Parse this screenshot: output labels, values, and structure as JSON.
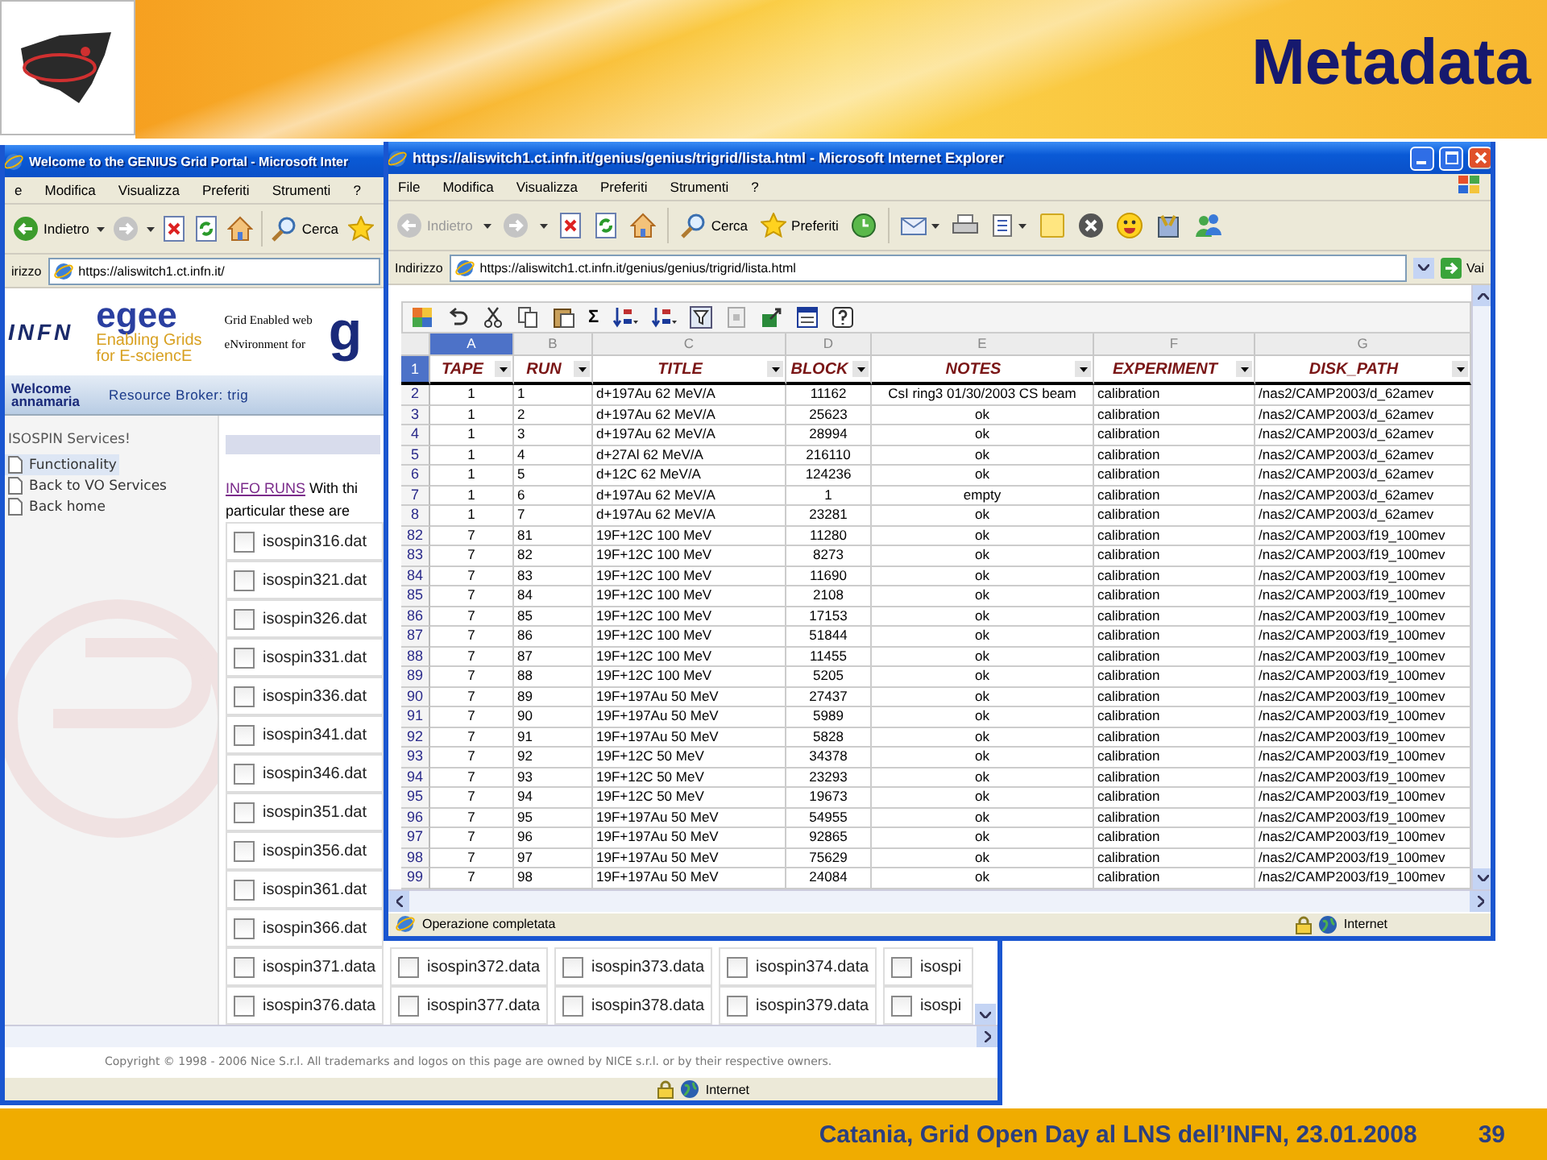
{
  "slide": {
    "title": "Metadata",
    "footer": "Catania, Grid Open Day al LNS dell’INFN, 23.01.2008",
    "page": "39"
  },
  "back_window": {
    "title": "Welcome to the GENIUS Grid Portal - Microsoft Inter",
    "menu": [
      "e",
      "Modifica",
      "Visualizza",
      "Preferiti",
      "Strumenti",
      "?"
    ],
    "back_button": {
      "label": "Indietro",
      "disabled": false
    },
    "search_button": "Cerca",
    "address_label": "irizzo",
    "url": "https://aliswitch1.ct.infn.it/",
    "logos": {
      "infn": "INFN",
      "egee": "egee",
      "egee_tagline": [
        "Enabling Grids",
        "for E-sciencE"
      ],
      "genius_tagline": [
        "Grid Enabled web",
        "eNvironment for"
      ],
      "genius": "g"
    },
    "welcome": [
      "Welcome",
      "annamaria"
    ],
    "broker": "Resource Broker: trig",
    "services_title": "ISOSPIN Services!",
    "nav": [
      {
        "label": "Functionality",
        "selected": true
      },
      {
        "label": "Back to VO Services",
        "selected": false
      },
      {
        "label": "Back home",
        "selected": false
      }
    ],
    "info_link": "INFO RUNS",
    "info_text": [
      "With thi",
      "particular these are"
    ],
    "files": [
      [
        {
          "name": "isospin316.dat",
          "checked": false
        }
      ],
      [
        {
          "name": "isospin321.dat",
          "checked": false
        }
      ],
      [
        {
          "name": "isospin326.dat",
          "checked": false
        }
      ],
      [
        {
          "name": "isospin331.dat",
          "checked": false
        }
      ],
      [
        {
          "name": "isospin336.dat",
          "checked": false
        }
      ],
      [
        {
          "name": "isospin341.dat",
          "checked": false
        }
      ],
      [
        {
          "name": "isospin346.dat",
          "checked": false
        }
      ],
      [
        {
          "name": "isospin351.dat",
          "checked": false
        }
      ],
      [
        {
          "name": "isospin356.dat",
          "checked": false
        }
      ],
      [
        {
          "name": "isospin361.dat",
          "checked": false
        }
      ],
      [
        {
          "name": "isospin366.dat",
          "checked": false
        }
      ],
      [
        {
          "name": "isospin371.data",
          "checked": false
        },
        {
          "name": "isospin372.data",
          "checked": false
        },
        {
          "name": "isospin373.data",
          "checked": false
        },
        {
          "name": "isospin374.data",
          "checked": false
        },
        {
          "name": "isospi",
          "checked": false
        }
      ],
      [
        {
          "name": "isospin376.data",
          "checked": false
        },
        {
          "name": "isospin377.data",
          "checked": false
        },
        {
          "name": "isospin378.data",
          "checked": false
        },
        {
          "name": "isospin379.data",
          "checked": false
        },
        {
          "name": "isospi",
          "checked": false
        }
      ]
    ],
    "copyright": "Copyright © 1998 - 2006 Nice S.r.l. All trademarks and logos on this page are owned by NICE s.r.l. or by their respective owners.",
    "status_zone": "Internet"
  },
  "front_window": {
    "title": "https://aliswitch1.ct.infn.it/genius/genius/trigrid/lista.html - Microsoft Internet Explorer",
    "menu": [
      "File",
      "Modifica",
      "Visualizza",
      "Preferiti",
      "Strumenti",
      "?"
    ],
    "back_button": {
      "label": "Indietro",
      "disabled": true
    },
    "search_button": "Cerca",
    "favorites_button": "Preferiti",
    "address_label": "Indirizzo",
    "url": "https://aliswitch1.ct.infn.it/genius/genius/trigrid/lista.html",
    "go_button": "Vai",
    "sheet_toolbar": [
      {
        "kind": "office"
      },
      {
        "kind": "undo"
      },
      {
        "kind": "cut"
      },
      {
        "kind": "copy"
      },
      {
        "kind": "paste"
      },
      {
        "kind": "sum",
        "glyph": "Σ"
      },
      {
        "kind": "sort"
      },
      {
        "kind": "sort"
      },
      {
        "kind": "filter"
      },
      {
        "kind": "refresh"
      },
      {
        "kind": "export"
      },
      {
        "kind": "form"
      },
      {
        "kind": "help"
      }
    ],
    "columns": [
      {
        "letter": "A",
        "selected": true
      },
      {
        "letter": "B",
        "selected": false
      },
      {
        "letter": "C",
        "selected": false
      },
      {
        "letter": "D",
        "selected": false
      },
      {
        "letter": "E",
        "selected": false
      },
      {
        "letter": "F",
        "selected": false
      },
      {
        "letter": "G",
        "selected": false
      }
    ],
    "header_row": {
      "n": "1",
      "selected": true,
      "fields": [
        "TAPE",
        "RUN",
        "TITLE",
        "BLOCK",
        "NOTES",
        "EXPERIMENT",
        "DISK_PATH"
      ]
    },
    "rows": [
      {
        "n": "2",
        "cells": [
          "1",
          "1",
          "d+197Au 62 MeV/A",
          "11162",
          "CsI ring3 01/30/2003 CS beam",
          "calibration",
          "/nas2/CAMP2003/d_62amev"
        ]
      },
      {
        "n": "3",
        "cells": [
          "1",
          "2",
          "d+197Au 62 MeV/A",
          "25623",
          "ok",
          "calibration",
          "/nas2/CAMP2003/d_62amev"
        ]
      },
      {
        "n": "4",
        "cells": [
          "1",
          "3",
          "d+197Au 62 MeV/A",
          "28994",
          "ok",
          "calibration",
          "/nas2/CAMP2003/d_62amev"
        ]
      },
      {
        "n": "5",
        "cells": [
          "1",
          "4",
          "d+27Al 62 MeV/A",
          "216110",
          "ok",
          "calibration",
          "/nas2/CAMP2003/d_62amev"
        ]
      },
      {
        "n": "6",
        "cells": [
          "1",
          "5",
          "d+12C 62 MeV/A",
          "124236",
          "ok",
          "calibration",
          "/nas2/CAMP2003/d_62amev"
        ]
      },
      {
        "n": "7",
        "cells": [
          "1",
          "6",
          "d+197Au 62 MeV/A",
          "1",
          "empty",
          "calibration",
          "/nas2/CAMP2003/d_62amev"
        ]
      },
      {
        "n": "8",
        "cells": [
          "1",
          "7",
          "d+197Au 62 MeV/A",
          "23281",
          "ok",
          "calibration",
          "/nas2/CAMP2003/d_62amev"
        ]
      },
      {
        "n": "82",
        "cells": [
          "7",
          "81",
          "19F+12C 100 MeV",
          "11280",
          "ok",
          "calibration",
          "/nas2/CAMP2003/f19_100mev"
        ]
      },
      {
        "n": "83",
        "cells": [
          "7",
          "82",
          "19F+12C 100 MeV",
          "8273",
          "ok",
          "calibration",
          "/nas2/CAMP2003/f19_100mev"
        ]
      },
      {
        "n": "84",
        "cells": [
          "7",
          "83",
          "19F+12C 100 MeV",
          "11690",
          "ok",
          "calibration",
          "/nas2/CAMP2003/f19_100mev"
        ]
      },
      {
        "n": "85",
        "cells": [
          "7",
          "84",
          "19F+12C 100 MeV",
          "2108",
          "ok",
          "calibration",
          "/nas2/CAMP2003/f19_100mev"
        ]
      },
      {
        "n": "86",
        "cells": [
          "7",
          "85",
          "19F+12C 100 MeV",
          "17153",
          "ok",
          "calibration",
          "/nas2/CAMP2003/f19_100mev"
        ]
      },
      {
        "n": "87",
        "cells": [
          "7",
          "86",
          "19F+12C 100 MeV",
          "51844",
          "ok",
          "calibration",
          "/nas2/CAMP2003/f19_100mev"
        ]
      },
      {
        "n": "88",
        "cells": [
          "7",
          "87",
          "19F+12C 100 MeV",
          "11455",
          "ok",
          "calibration",
          "/nas2/CAMP2003/f19_100mev"
        ]
      },
      {
        "n": "89",
        "cells": [
          "7",
          "88",
          "19F+12C 100 MeV",
          "5205",
          "ok",
          "calibration",
          "/nas2/CAMP2003/f19_100mev"
        ]
      },
      {
        "n": "90",
        "cells": [
          "7",
          "89",
          "19F+197Au 50 MeV",
          "27437",
          "ok",
          "calibration",
          "/nas2/CAMP2003/f19_100mev"
        ]
      },
      {
        "n": "91",
        "cells": [
          "7",
          "90",
          "19F+197Au 50 MeV",
          "5989",
          "ok",
          "calibration",
          "/nas2/CAMP2003/f19_100mev"
        ]
      },
      {
        "n": "92",
        "cells": [
          "7",
          "91",
          "19F+197Au 50 MeV",
          "5828",
          "ok",
          "calibration",
          "/nas2/CAMP2003/f19_100mev"
        ]
      },
      {
        "n": "93",
        "cells": [
          "7",
          "92",
          "19F+12C 50 MeV",
          "34378",
          "ok",
          "calibration",
          "/nas2/CAMP2003/f19_100mev"
        ]
      },
      {
        "n": "94",
        "cells": [
          "7",
          "93",
          "19F+12C 50 MeV",
          "23293",
          "ok",
          "calibration",
          "/nas2/CAMP2003/f19_100mev"
        ]
      },
      {
        "n": "95",
        "cells": [
          "7",
          "94",
          "19F+12C 50 MeV",
          "19673",
          "ok",
          "calibration",
          "/nas2/CAMP2003/f19_100mev"
        ]
      },
      {
        "n": "96",
        "cells": [
          "7",
          "95",
          "19F+197Au 50 MeV",
          "54955",
          "ok",
          "calibration",
          "/nas2/CAMP2003/f19_100mev"
        ]
      },
      {
        "n": "97",
        "cells": [
          "7",
          "96",
          "19F+197Au 50 MeV",
          "92865",
          "ok",
          "calibration",
          "/nas2/CAMP2003/f19_100mev"
        ]
      },
      {
        "n": "98",
        "cells": [
          "7",
          "97",
          "19F+197Au 50 MeV",
          "75629",
          "ok",
          "calibration",
          "/nas2/CAMP2003/f19_100mev"
        ]
      },
      {
        "n": "99",
        "cells": [
          "7",
          "98",
          "19F+197Au 50 MeV",
          "24084",
          "ok",
          "calibration",
          "/nas2/CAMP2003/f19_100mev"
        ]
      }
    ],
    "status": "Operazione completata",
    "status_zone": "Internet"
  }
}
